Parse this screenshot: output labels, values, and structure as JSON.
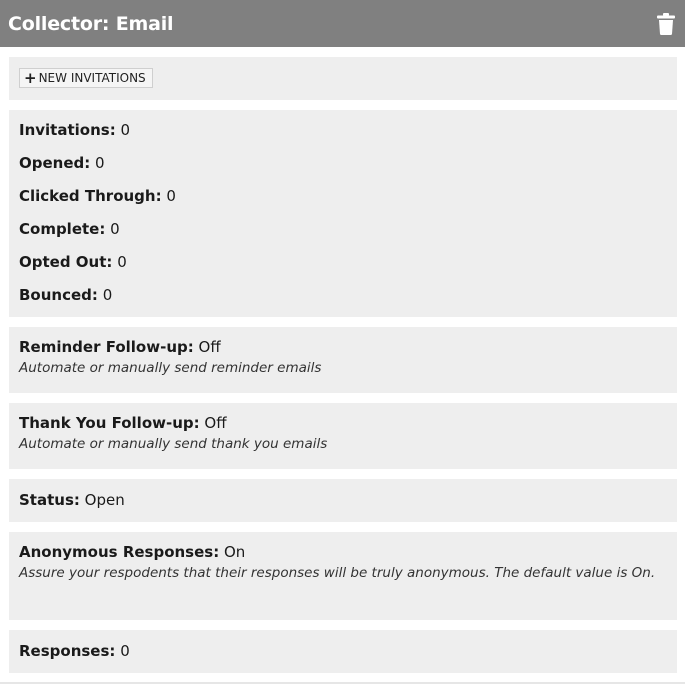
{
  "header": {
    "title": "Collector: Email",
    "delete_icon": "trash-icon"
  },
  "new_invitations": {
    "label": "NEW INVITATIONS",
    "icon": "plus-icon"
  },
  "stats": [
    {
      "label": "Invitations:",
      "value": "0"
    },
    {
      "label": "Opened:",
      "value": "0"
    },
    {
      "label": "Clicked Through:",
      "value": "0"
    },
    {
      "label": "Complete:",
      "value": "0"
    },
    {
      "label": "Opted Out:",
      "value": "0"
    },
    {
      "label": "Bounced:",
      "value": "0"
    }
  ],
  "reminder": {
    "label": "Reminder Follow-up:",
    "value": "Off",
    "description": "Automate or manually send reminder emails"
  },
  "thankyou": {
    "label": "Thank You Follow-up:",
    "value": "Off",
    "description": "Automate or manually send thank you emails"
  },
  "status": {
    "label": "Status:",
    "value": "Open"
  },
  "anonymous": {
    "label": "Anonymous Responses:",
    "value": "On",
    "description": "Assure your respodents that their responses will be truly anonymous. The default value is On."
  },
  "responses": {
    "label": "Responses:",
    "value": "0"
  }
}
